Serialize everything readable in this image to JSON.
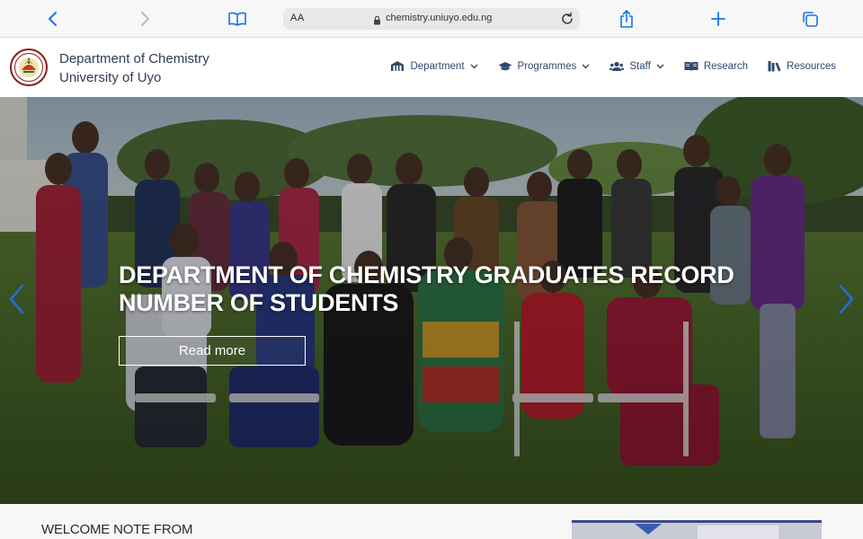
{
  "browser": {
    "text_size_label": "AA",
    "url": "chemistry.uniuyo.edu.ng"
  },
  "site": {
    "name_line1": "Department of Chemistry",
    "name_line2": "University of Uyo"
  },
  "nav": {
    "items": [
      {
        "label": "Department",
        "icon": "building-icon",
        "has_dropdown": true
      },
      {
        "label": "Programmes",
        "icon": "graduation-cap-icon",
        "has_dropdown": true
      },
      {
        "label": "Staff",
        "icon": "users-icon",
        "has_dropdown": true
      },
      {
        "label": "Research",
        "icon": "book-open-icon",
        "has_dropdown": false
      },
      {
        "label": "Resources",
        "icon": "books-icon",
        "has_dropdown": false
      }
    ]
  },
  "hero": {
    "title": "DEPARTMENT OF CHEMISTRY GRADUATES RECORD NUMBER OF STUDENTS",
    "button_label": "Read more"
  },
  "welcome": {
    "title": "WELCOME NOTE FROM"
  },
  "colors": {
    "nav_text": "#2f4a6d",
    "arrow_accent": "#1e6fd9",
    "browser_accent": "#1a73e8"
  }
}
